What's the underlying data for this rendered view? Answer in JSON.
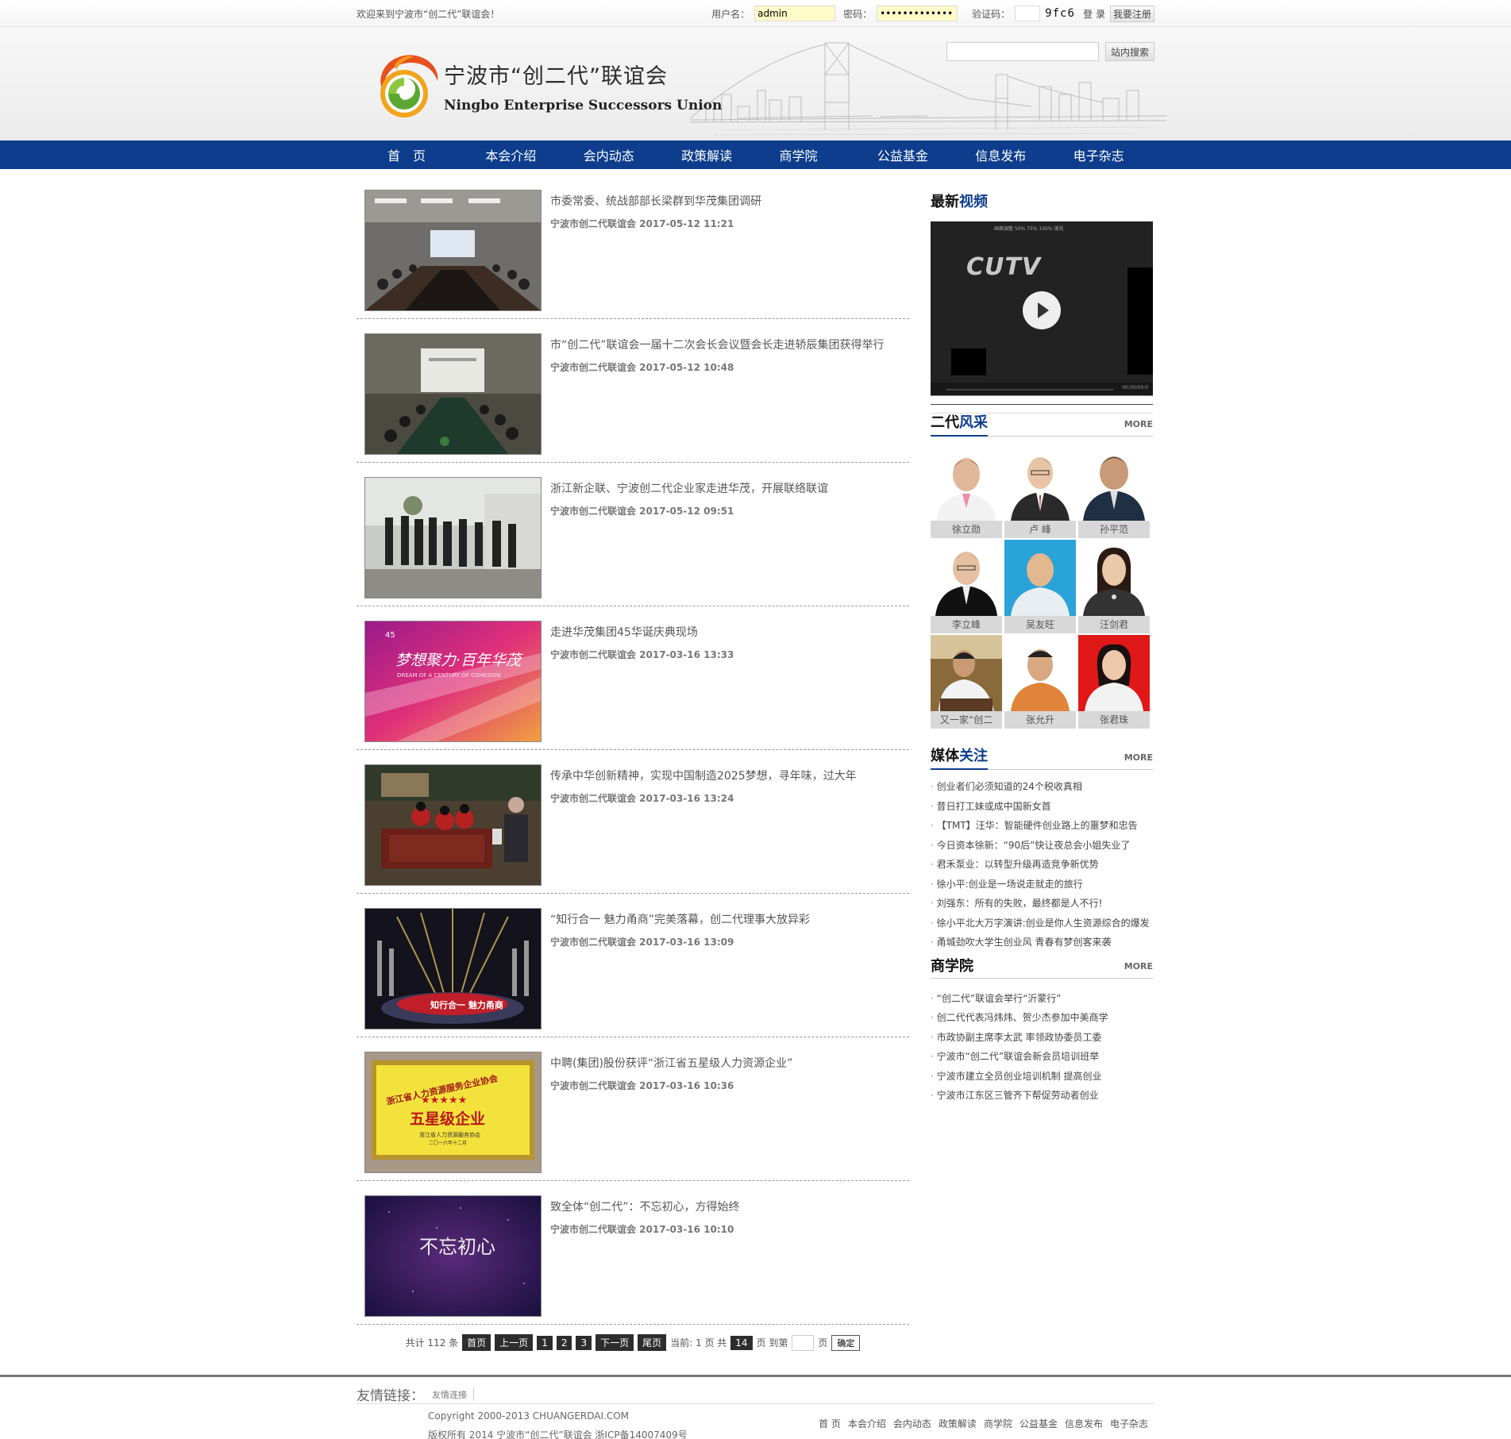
{
  "topbar": {
    "welcome": "欢迎来到宁波市“创二代”联谊会！",
    "username_label": "用户名：",
    "username_value": "admin",
    "password_label": "密码：",
    "password_value": "••••••••••••••",
    "captcha_label": "验证码：",
    "captcha_text": "9fc6",
    "login_button": "登 录",
    "register_button": "我要注册"
  },
  "header": {
    "logo_cn": "宁波市“创二代”联谊会",
    "logo_en": "Ningbo Enterprise Successors Union",
    "search_button": "站内搜索"
  },
  "nav": [
    "首　页",
    "本会介绍",
    "会内动态",
    "政策解读",
    "商学院",
    "公益基金",
    "信息发布",
    "电子杂志"
  ],
  "news": [
    {
      "title": "市委常委、统战部部长梁群到华茂集团调研",
      "meta": "宁波市创二代联谊会 2017-05-12 11:21"
    },
    {
      "title": "市“创二代”联谊会一届十二次会长会议暨会长走进轿辰集团获得举行",
      "meta": "宁波市创二代联谊会 2017-05-12 10:48"
    },
    {
      "title": "浙江新企联、宁波创二代企业家走进华茂，开展联络联谊",
      "meta": "宁波市创二代联谊会 2017-05-12 09:51"
    },
    {
      "title": "走进华茂集团45华诞庆典现场",
      "meta": "宁波市创二代联谊会 2017-03-16 13:33"
    },
    {
      "title": "传承中华创新精神，实现中国制造2025梦想，寻年味，过大年",
      "meta": "宁波市创二代联谊会 2017-03-16 13:24"
    },
    {
      "title": "“知行合一 魅力甬商”完美落幕，创二代理事大放异彩",
      "meta": "宁波市创二代联谊会 2017-03-16 13:09"
    },
    {
      "title": "中聘(集团)股份获评“浙江省五星级人力资源企业”",
      "meta": "宁波市创二代联谊会 2017-03-16 10:36"
    },
    {
      "title": "致全体“创二代”：不忘初心，方得始终",
      "meta": "宁波市创二代联谊会 2017-03-16 10:10"
    }
  ],
  "thumb_text": {
    "t4_cn": "梦想聚力·百年华茂",
    "t4_en": "DREAM OF A CENTURY OF COHESION",
    "t4_num": "45",
    "t6_sign": "知行合一 魅力甬商",
    "t7_line1": "浙江省人力资源服务企业协会",
    "t7_stars": "★★★★★",
    "t7_main": "五星级企业",
    "t7_org": "浙江省人力资源服务协会",
    "t7_date": "二〇一六年十二月",
    "t8_main": "不忘初心"
  },
  "pager": {
    "total": "共计 112 条",
    "first": "首页",
    "prev": "上一页",
    "pages": [
      "1",
      "2",
      "3"
    ],
    "next": "下一页",
    "last": "尾页",
    "current": "当前: 1 页 共",
    "total_pages": "14",
    "goto": "页 到第",
    "page_unit": "页",
    "confirm": "确定"
  },
  "video": {
    "title_a": "最新",
    "title_b": "视频",
    "brand": "CUTV",
    "toolbar": "画面调整  50%  75%  100%  填充",
    "time": "00:00/00:0"
  },
  "people": {
    "title_a": "二代",
    "title_b": "风采",
    "more": "MORE",
    "items": [
      "徐立勋",
      "卢 峰",
      "孙平范",
      "李立峰",
      "吴友旺",
      "汪剑君",
      "又一家“创二",
      "张允升",
      "张君珠"
    ]
  },
  "media": {
    "title_a": "媒体",
    "title_b": "关注",
    "more": "MORE",
    "items": [
      "创业者们必须知道的24个税收真相",
      "昔日打工妹或成中国新女首",
      "【TMT】汪华：智能硬件创业路上的噩梦和忠告",
      "今日资本徐新：“90后”快让夜总会小姐失业了",
      "君禾泵业：以转型升级再造竞争新优势",
      "徐小平:创业是一场说走就走的旅行",
      "刘强东：所有的失败，最终都是人不行!",
      "徐小平北大万字演讲:创业是你人生资源综合的爆发",
      "甬城劲吹大学生创业风 青春有梦创客来袭"
    ]
  },
  "school": {
    "title": "商学院",
    "more": "MORE",
    "items": [
      "“创二代”联谊会举行“沂蒙行”",
      "创二代代表冯炜炜、贺少杰参加中美商学",
      "市政协副主席李太武 率领政协委员工委",
      "宁波市“创二代”联谊会新会员培训班举",
      "宁波市建立全员创业培训机制 提高创业",
      "宁波市江东区三管齐下帮促劳动者创业"
    ]
  },
  "footer": {
    "label": "友情链接：",
    "link": "友情连接",
    "copyright": "Copyright 2000-2013 CHUANGERDAI.COM",
    "icp": "版权所有 2014 宁波市“创二代”联谊会 浙ICP备14007409号",
    "nav": [
      "首 页",
      "本会介绍",
      "会内动态",
      "政策解读",
      "商学院",
      "公益基金",
      "信息发布",
      "电子杂志"
    ]
  },
  "colors": {
    "nav_bg": "#0d3d8c",
    "accent": "#0d3d8c",
    "pager_bg": "#2d2d2d"
  }
}
